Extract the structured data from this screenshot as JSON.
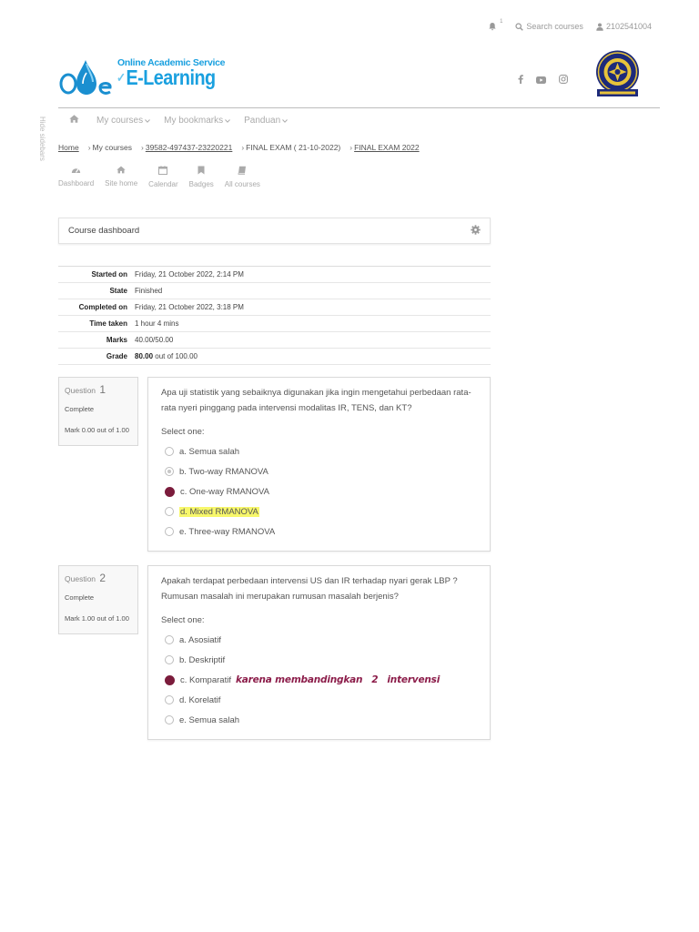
{
  "topbar": {
    "bell_count": "1",
    "search_label": "Search courses",
    "user_id": "2102541004"
  },
  "logo": {
    "line1": "Online Academic Service",
    "line2": "E-Learning"
  },
  "sidebar_toggle": "Hide sidebars",
  "nav": {
    "items": [
      "My courses",
      "My bookmarks",
      "Panduan"
    ]
  },
  "breadcrumb": [
    "Home",
    "My courses",
    "39582-497437-23220221",
    "FINAL EXAM ( 21-10-2022)",
    "FINAL EXAM 2022"
  ],
  "quicklinks": [
    "Dashboard",
    "Site home",
    "Calendar",
    "Badges",
    "All courses"
  ],
  "course_dashboard": "Course dashboard",
  "summary": {
    "started_on": {
      "label": "Started on",
      "value": "Friday, 21 October 2022, 2:14 PM"
    },
    "state": {
      "label": "State",
      "value": "Finished"
    },
    "completed_on": {
      "label": "Completed on",
      "value": "Friday, 21 October 2022, 3:18 PM"
    },
    "time_taken": {
      "label": "Time taken",
      "value": "1 hour 4 mins"
    },
    "marks": {
      "label": "Marks",
      "value": "40.00/50.00"
    },
    "grade": {
      "label": "Grade",
      "value_bold": "80.00",
      "value_rest": " out of 100.00"
    }
  },
  "questions": [
    {
      "label": "Question",
      "number": "1",
      "status": "Complete",
      "mark": "Mark 0.00 out of 1.00",
      "text": "Apa uji statistik yang sebaiknya digunakan jika ingin mengetahui perbedaan rata-rata nyeri pinggang pada intervensi modalitas IR, TENS, dan KT?",
      "select_label": "Select one:",
      "options": [
        "a. Semua salah",
        "b. Two-way RMANOVA",
        "c. One-way RMANOVA",
        "d. Mixed RMANOVA",
        "e. Three-way RMANOVA"
      ]
    },
    {
      "label": "Question",
      "number": "2",
      "status": "Complete",
      "mark": "Mark 1.00 out of 1.00",
      "text": "Apakah terdapat perbedaan intervensi US dan IR terhadap nyari gerak LBP ? Rumusan masalah ini merupakan rumusan masalah berjenis?",
      "select_label": "Select one:",
      "options": [
        "a. Asosiatif",
        "b. Deskriptif",
        "c. Komparatif",
        "d. Korelatif",
        "e. Semua salah"
      ],
      "handwritten_note": [
        "karena membandingkan",
        "2",
        "intervensi"
      ]
    }
  ],
  "colors": {
    "accent": "#7b1c3c",
    "logo_blue": "#1aa0df",
    "highlight": "#f7f76a"
  }
}
